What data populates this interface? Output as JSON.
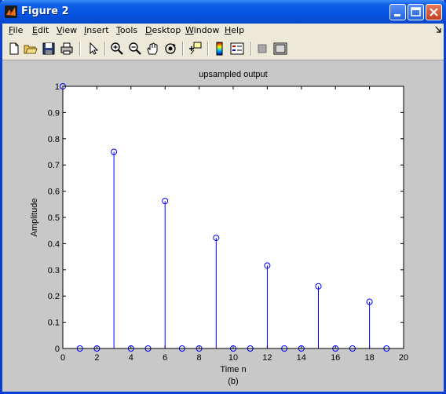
{
  "window": {
    "title": "Figure 2",
    "buttons": [
      "minimize",
      "maximize",
      "close"
    ]
  },
  "menu": {
    "items": [
      {
        "label": "File",
        "underline": "F",
        "rest": "ile"
      },
      {
        "label": "Edit",
        "underline": "E",
        "rest": "dit"
      },
      {
        "label": "View",
        "underline": "V",
        "rest": "iew"
      },
      {
        "label": "Insert",
        "underline": "I",
        "rest": "nsert"
      },
      {
        "label": "Tools",
        "underline": "T",
        "rest": "ools"
      },
      {
        "label": "Desktop",
        "underline": "D",
        "rest": "esktop"
      },
      {
        "label": "Window",
        "underline": "W",
        "rest": "indow"
      },
      {
        "label": "Help",
        "underline": "H",
        "rest": "elp"
      }
    ]
  },
  "toolbar": {
    "icons": [
      "new-file-icon",
      "open-folder-icon",
      "save-icon",
      "print-icon",
      "select-arrow-icon",
      "zoom-in-icon",
      "zoom-out-icon",
      "pan-hand-icon",
      "rotate-3d-icon",
      "data-cursor-icon",
      "colorbar-icon",
      "legend-icon",
      "hide-plot-tools-icon",
      "show-plot-tools-icon"
    ]
  },
  "chart_data": {
    "type": "stem",
    "title": "upsampled output",
    "xlabel": "Time n",
    "ylabel": "Amplitude",
    "caption": "(b)",
    "xlim": [
      0,
      20
    ],
    "ylim": [
      0,
      1
    ],
    "xticks": [
      "0",
      "2",
      "4",
      "6",
      "8",
      "10",
      "12",
      "14",
      "16",
      "18",
      "20"
    ],
    "yticks": [
      "0",
      "0.1",
      "0.2",
      "0.3",
      "0.4",
      "0.5",
      "0.6",
      "0.7",
      "0.8",
      "0.9",
      "1"
    ],
    "x": [
      0,
      1,
      2,
      3,
      4,
      5,
      6,
      7,
      8,
      9,
      10,
      11,
      12,
      13,
      14,
      15,
      16,
      17,
      18,
      19
    ],
    "values": [
      1,
      0,
      0,
      0.75,
      0,
      0,
      0.5625,
      0,
      0,
      0.4219,
      0,
      0,
      0.3164,
      0,
      0,
      0.2373,
      0,
      0,
      0.178,
      0
    ],
    "color": "#0000ff"
  }
}
